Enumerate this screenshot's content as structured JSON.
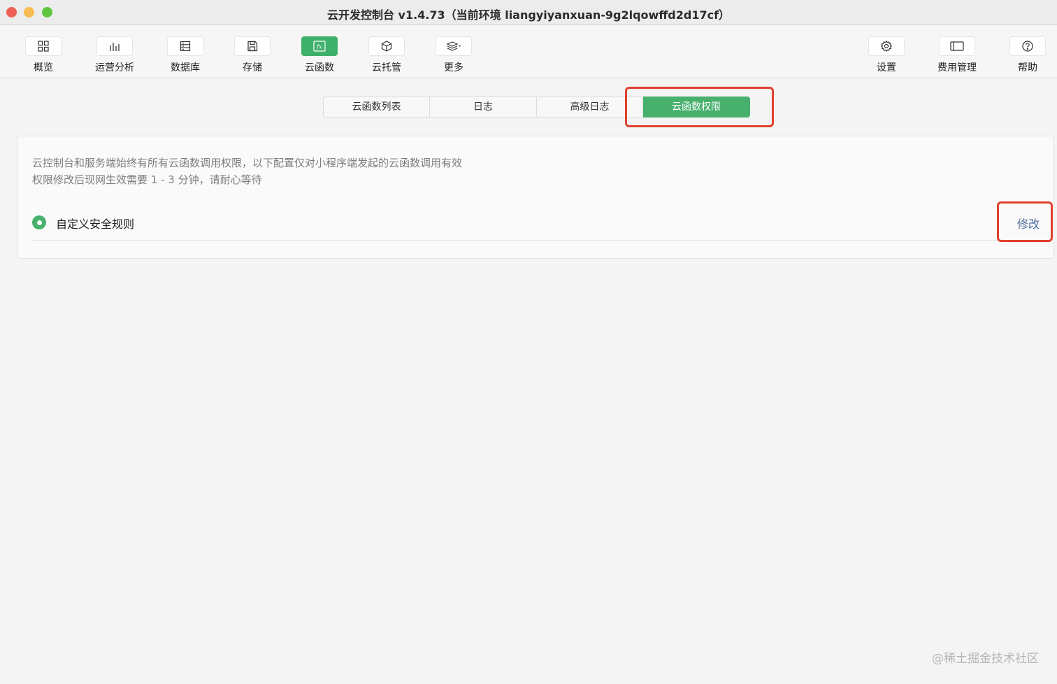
{
  "window": {
    "title": "云开发控制台 v1.4.73（当前环境 liangyiyanxuan-9g2lqowffd2d17cf）"
  },
  "toolbar": {
    "items": [
      {
        "label": "概览",
        "icon": "grid-icon"
      },
      {
        "label": "运营分析",
        "icon": "bar-chart-icon"
      },
      {
        "label": "数据库",
        "icon": "database-icon"
      },
      {
        "label": "存储",
        "icon": "save-icon"
      },
      {
        "label": "云函数",
        "icon": "function-icon",
        "active": true
      },
      {
        "label": "云托管",
        "icon": "cube-icon"
      },
      {
        "label": "更多",
        "icon": "layers-icon"
      }
    ],
    "right_items": [
      {
        "label": "设置",
        "icon": "gear-icon"
      },
      {
        "label": "费用管理",
        "icon": "billing-icon"
      },
      {
        "label": "帮助",
        "icon": "help-icon"
      }
    ]
  },
  "tabs": [
    {
      "label": "云函数列表"
    },
    {
      "label": "日志"
    },
    {
      "label": "高级日志"
    },
    {
      "label": "云函数权限",
      "active": true
    }
  ],
  "panel": {
    "description_line1": "云控制台和服务端始终有所有云函数调用权限，以下配置仅对小程序端发起的云函数调用有效",
    "description_line2": "权限修改后现网生效需要 1 - 3 分钟，请耐心等待",
    "rule_label": "自定义安全规则",
    "rule_selected": true,
    "modify_label": "修改"
  },
  "watermark": "@稀土掘金技术社区",
  "colors": {
    "accent": "#48b06d",
    "highlight": "#e0412e",
    "link": "#4a6a9c"
  }
}
